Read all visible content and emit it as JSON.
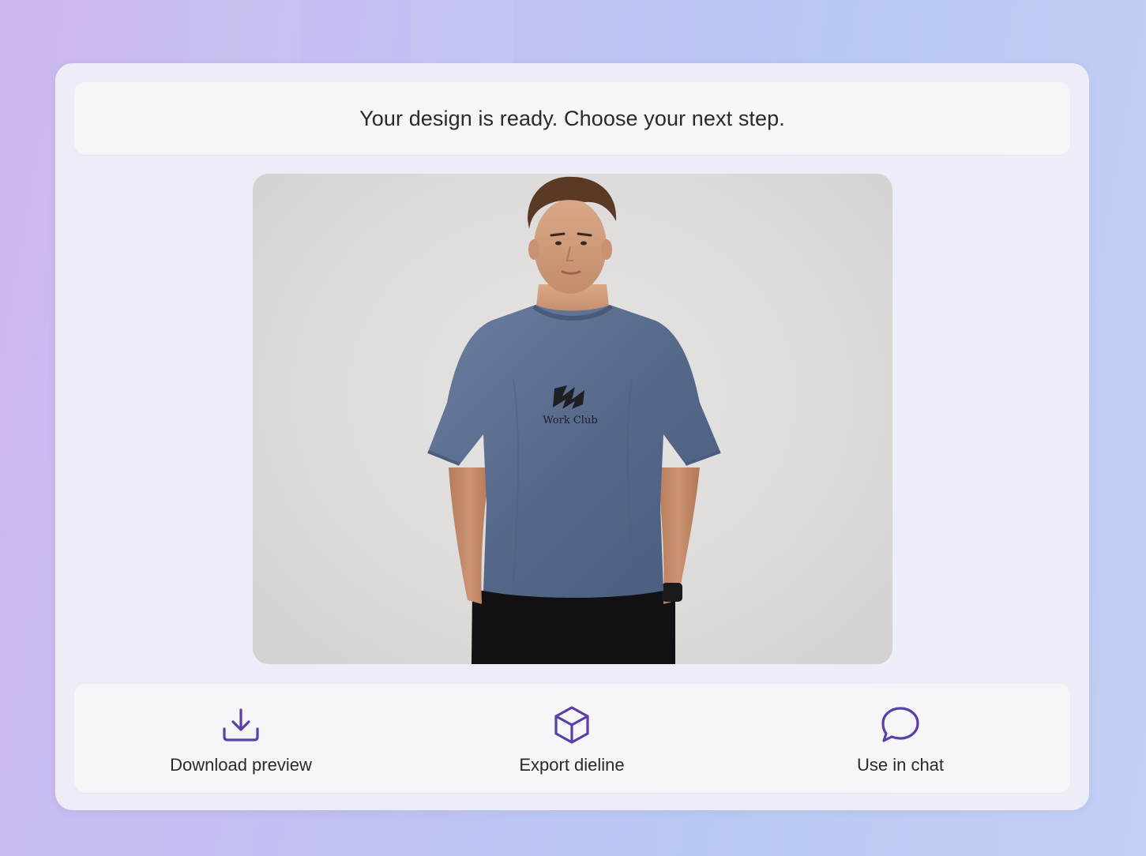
{
  "header": {
    "message": "Your design is ready. Choose your next step."
  },
  "preview": {
    "alt": "Model wearing blue oversized t-shirt with Work Club logo",
    "shirt_print_text": "Work Club"
  },
  "actions": [
    {
      "label": "Download preview",
      "icon": "download-icon"
    },
    {
      "label": "Export dieline",
      "icon": "box-icon"
    },
    {
      "label": "Use in chat",
      "icon": "chat-bubble-icon"
    }
  ],
  "colors": {
    "accent": "#5b3fa8",
    "text": "#2a2a2e",
    "card": "#f0f0f8",
    "shirt": "#56698a"
  }
}
